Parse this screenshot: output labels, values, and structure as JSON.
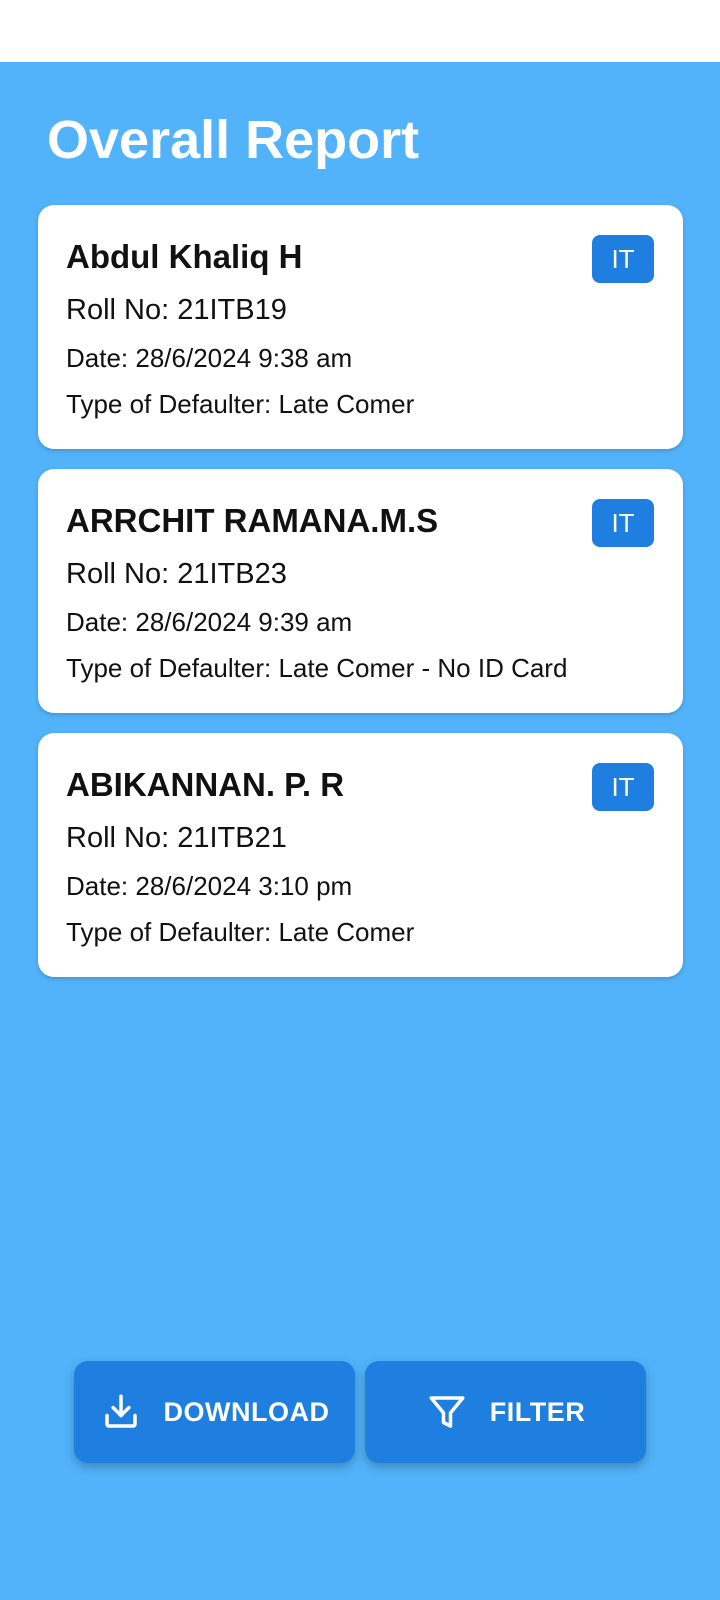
{
  "page": {
    "title": "Overall Report"
  },
  "records": [
    {
      "name": "Abdul Khaliq H",
      "roll": "Roll No: 21ITB19",
      "date": "Date: 28/6/2024 9:38 am",
      "type": "Type of Defaulter: Late Comer",
      "dept": "IT"
    },
    {
      "name": "ARRCHIT RAMANA.M.S",
      "roll": "Roll No: 21ITB23",
      "date": "Date: 28/6/2024 9:39 am",
      "type": "Type of Defaulter: Late Comer - No ID Card",
      "dept": "IT"
    },
    {
      "name": "ABIKANNAN. P. R",
      "roll": "Roll No: 21ITB21",
      "date": "Date: 28/6/2024 3:10 pm",
      "type": "Type of Defaulter: Late Comer",
      "dept": "IT"
    }
  ],
  "actions": {
    "download_label": "DOWNLOAD",
    "download_icon": "download-icon",
    "filter_label": "FILTER",
    "filter_icon": "filter-icon"
  },
  "colors": {
    "background": "#52b3fa",
    "accent": "#1e7fe0",
    "card": "#ffffff"
  }
}
